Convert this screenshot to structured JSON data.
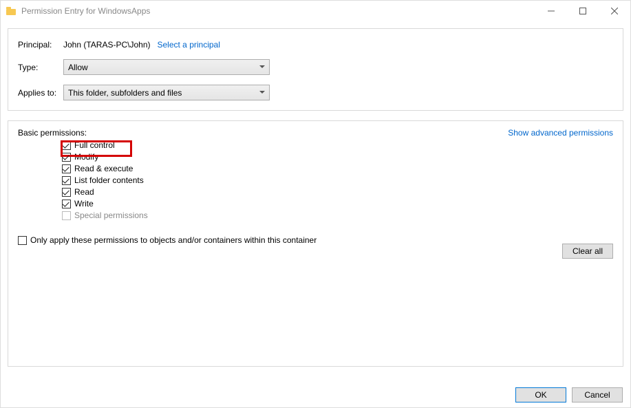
{
  "titlebar": {
    "text": "Permission Entry for WindowsApps"
  },
  "principal": {
    "label": "Principal:",
    "value": "John (TARAS-PC\\John)",
    "select_link": "Select a principal"
  },
  "type": {
    "label": "Type:",
    "value": "Allow"
  },
  "applies": {
    "label": "Applies to:",
    "value": "This folder, subfolders and files"
  },
  "permissions": {
    "header": "Basic permissions:",
    "advanced_link": "Show advanced permissions",
    "items": [
      {
        "label": "Full control",
        "checked": true,
        "disabled": false
      },
      {
        "label": "Modify",
        "checked": true,
        "disabled": false
      },
      {
        "label": "Read & execute",
        "checked": true,
        "disabled": false
      },
      {
        "label": "List folder contents",
        "checked": true,
        "disabled": false
      },
      {
        "label": "Read",
        "checked": true,
        "disabled": false
      },
      {
        "label": "Write",
        "checked": true,
        "disabled": false
      },
      {
        "label": "Special permissions",
        "checked": false,
        "disabled": true
      }
    ]
  },
  "only_apply": {
    "label": "Only apply these permissions to objects and/or containers within this container",
    "checked": false
  },
  "buttons": {
    "clear": "Clear all",
    "ok": "OK",
    "cancel": "Cancel"
  }
}
